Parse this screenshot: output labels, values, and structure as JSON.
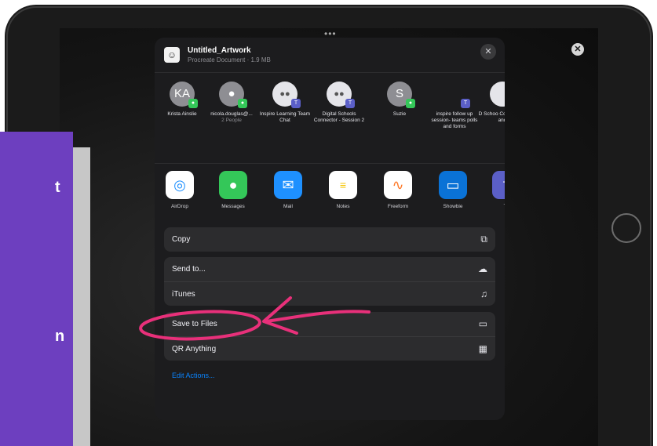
{
  "document": {
    "title": "Untitled_Artwork",
    "subtitle": "Procreate Document · 1.9 MB"
  },
  "people": [
    {
      "initials": "KA",
      "name": "Krista Ainslie",
      "sub": "",
      "badge": "message"
    },
    {
      "initials": "",
      "name": "nicola.douglas@...",
      "sub": "2 People",
      "badge": "message"
    },
    {
      "initials": "",
      "name": "Inspire Learning Team Chat",
      "sub": "",
      "badge": "teams"
    },
    {
      "initials": "",
      "name": "Digital Schools Connector - Session 2",
      "sub": "",
      "badge": "teams"
    },
    {
      "initials": "S",
      "name": "Suzie",
      "sub": "",
      "badge": "message"
    },
    {
      "initials": "",
      "name": "inspire follow up session- teams polls and forms",
      "sub": "",
      "badge": "teams"
    },
    {
      "initials": "",
      "name": "D Schoo Co Ses Lea and",
      "sub": "",
      "badge": ""
    }
  ],
  "apps": [
    {
      "name": "AirDrop",
      "icon": "airdrop-icon",
      "color": "#ffffff"
    },
    {
      "name": "Messages",
      "icon": "messages-icon",
      "color": "#34c759"
    },
    {
      "name": "Mail",
      "icon": "mail-icon",
      "color": "#1e90ff"
    },
    {
      "name": "Notes",
      "icon": "notes-icon",
      "color": "#ffffff"
    },
    {
      "name": "Freeform",
      "icon": "freeform-icon",
      "color": "#ffffff"
    },
    {
      "name": "Showbie",
      "icon": "showbie-icon",
      "color": "#0a72d6"
    },
    {
      "name": "Te",
      "icon": "teams-icon",
      "color": "#5b5fc7"
    }
  ],
  "actions": {
    "copy": "Copy",
    "send_to": "Send to...",
    "itunes": "iTunes",
    "save_to_files": "Save to Files",
    "qr_anything": "QR Anything",
    "edit_actions": "Edit Actions..."
  },
  "background": {
    "letters": [
      "t",
      "n"
    ]
  },
  "colors": {
    "annotation": "#e8307a",
    "accent": "#0a84ff",
    "purple_panel": "#6d3fbf"
  }
}
